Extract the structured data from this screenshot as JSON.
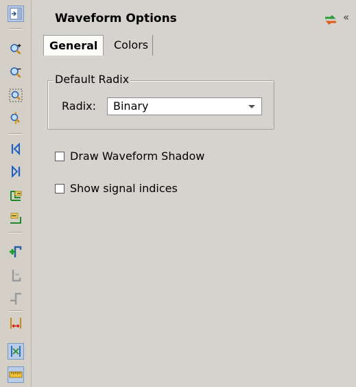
{
  "window": {
    "title": "Waveform Options"
  },
  "toolbar": {
    "items": [
      {
        "icon": "dock-toggle-icon",
        "active": true
      },
      {
        "icon": "zoom-in-icon"
      },
      {
        "icon": "zoom-out-icon"
      },
      {
        "icon": "zoom-fit-icon"
      },
      {
        "icon": "zoom-cursor-icon"
      },
      {
        "icon": "go-to-start-icon"
      },
      {
        "icon": "go-to-end-icon"
      },
      {
        "icon": "previous-edge-icon"
      },
      {
        "icon": "next-edge-icon"
      },
      {
        "icon": "add-marker-icon"
      },
      {
        "icon": "remove-marker-icon"
      },
      {
        "icon": "marker-icon"
      },
      {
        "icon": "measure-icon"
      },
      {
        "icon": "swap-cursors-icon",
        "active": true
      },
      {
        "icon": "ruler-icon",
        "active": true
      }
    ]
  },
  "tabs": {
    "general": "General",
    "colors": "Colors"
  },
  "default_radix": {
    "legend": "Default Radix",
    "label": "Radix:",
    "value": "Binary"
  },
  "options": {
    "draw_shadow": {
      "label": "Draw Waveform Shadow",
      "checked": false
    },
    "signal_indices": {
      "label": "Show signal indices",
      "checked": false
    }
  },
  "header": {
    "collapse": "«"
  }
}
